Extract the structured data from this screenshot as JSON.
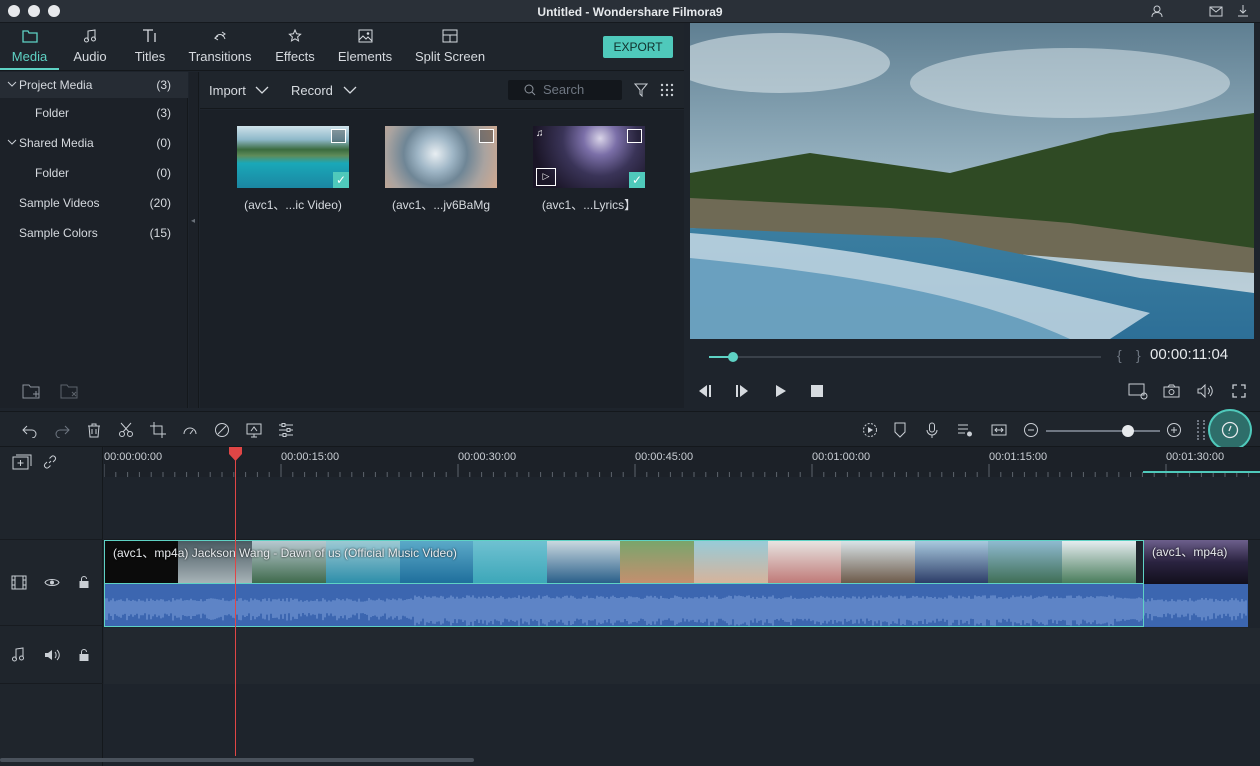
{
  "window": {
    "title": "Untitled - Wondershare Filmora9"
  },
  "topnav": {
    "tabs": [
      {
        "label": "Media",
        "icon": "folder-icon",
        "active": true
      },
      {
        "label": "Audio",
        "icon": "music-note-icon"
      },
      {
        "label": "Titles",
        "icon": "text-icon"
      },
      {
        "label": "Transitions",
        "icon": "transitions-icon"
      },
      {
        "label": "Effects",
        "icon": "effects-icon"
      },
      {
        "label": "Elements",
        "icon": "image-icon"
      },
      {
        "label": "Split Screen",
        "icon": "split-screen-icon"
      }
    ],
    "export_label": "EXPORT"
  },
  "tree": {
    "items": [
      {
        "label": "Project Media",
        "count": "(3)",
        "expanded": true
      },
      {
        "label": "Folder",
        "count": "(3)"
      },
      {
        "label": "Shared Media",
        "count": "(0)",
        "expanded": true
      },
      {
        "label": "Folder",
        "count": "(0)"
      },
      {
        "label": "Sample Videos",
        "count": "(20)"
      },
      {
        "label": "Sample Colors",
        "count": "(15)"
      }
    ]
  },
  "media": {
    "import_label": "Import",
    "record_label": "Record",
    "search_placeholder": "Search",
    "items": [
      {
        "caption": "(avc1、...ic Video)"
      },
      {
        "caption": "(avc1、...jv6BaMg"
      },
      {
        "caption": "(avc1、...Lyrics】"
      }
    ]
  },
  "preview": {
    "timecode": "00:00:11:04",
    "progress": 0.06
  },
  "timeline": {
    "ruler_labels": [
      "00:00:00:00",
      "00:00:15:00",
      "00:00:30:00",
      "00:00:45:00",
      "00:01:00:00",
      "00:01:15:00",
      "00:01:30:00"
    ],
    "clip1_title": "(avc1、mp4a) Jackson Wang - Dawn of us (Official Music Video)",
    "clip2_title": "(avc1、mp4a)",
    "zoom_level": 0.72
  },
  "colors": {
    "accent": "#5ed2c4",
    "playhead": "#e04646",
    "audio": "#3c66b0"
  }
}
